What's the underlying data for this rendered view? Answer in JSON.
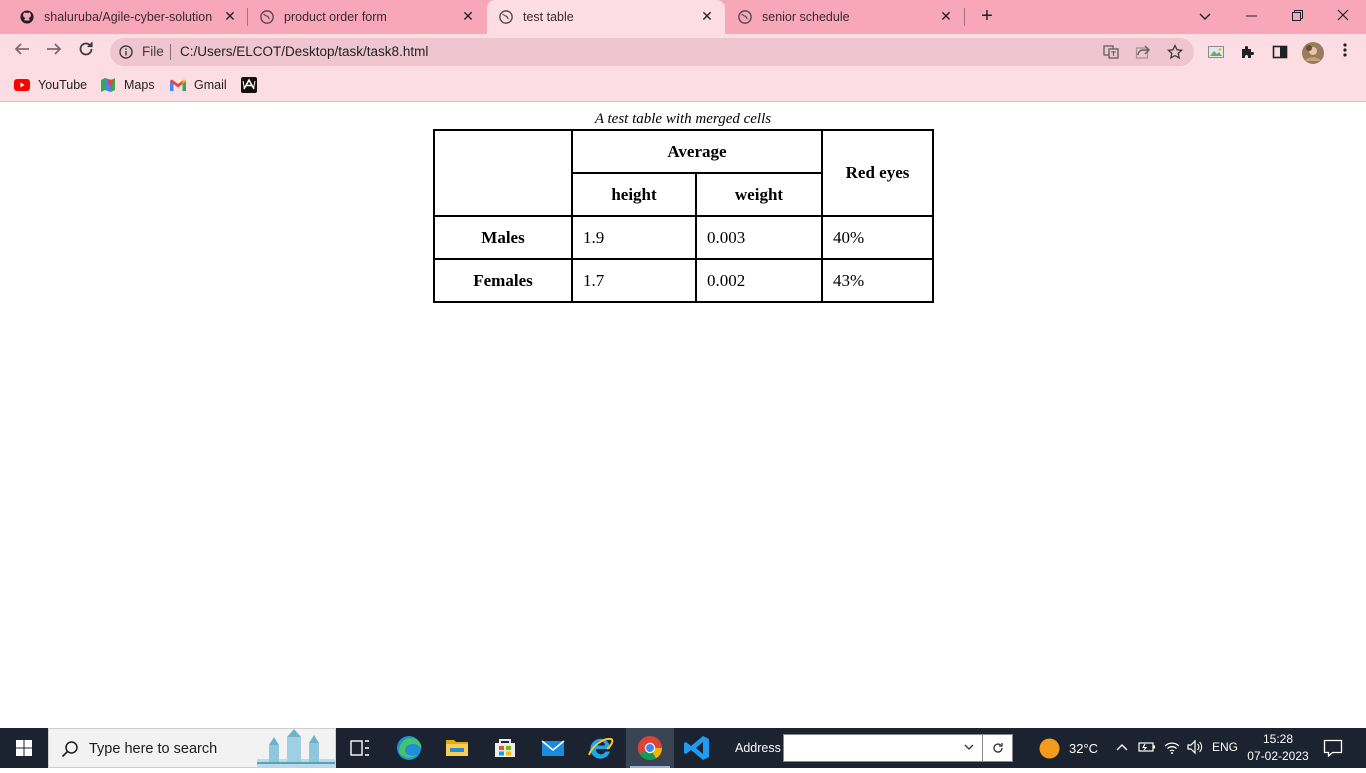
{
  "tabs": [
    {
      "title": "shaluruba/Agile-cyber-solution",
      "icon": "github-icon"
    },
    {
      "title": "product order form",
      "icon": "globe-icon"
    },
    {
      "title": "test table",
      "icon": "globe-icon",
      "active": true
    },
    {
      "title": "senior schedule",
      "icon": "globe-icon"
    }
  ],
  "toolbar": {
    "scheme_label": "File",
    "url": "C:/Users/ELCOT/Desktop/task/task8.html"
  },
  "bookmarks": [
    {
      "label": "YouTube",
      "icon": "youtube-icon"
    },
    {
      "label": "Maps",
      "icon": "maps-icon"
    },
    {
      "label": "Gmail",
      "icon": "gmail-icon"
    },
    {
      "label": "",
      "icon": "app-icon"
    }
  ],
  "page": {
    "caption": "A test table with merged cells",
    "headers": {
      "average": "Average",
      "height": "height",
      "weight": "weight",
      "red_eyes": "Red eyes"
    },
    "rows": [
      {
        "label": "Males",
        "height": "1.9",
        "weight": "0.003",
        "red_eyes": "40%"
      },
      {
        "label": "Females",
        "height": "1.7",
        "weight": "0.002",
        "red_eyes": "43%"
      }
    ]
  },
  "taskbar": {
    "search_placeholder": "Type here to search",
    "address_label": "Address",
    "address_value": "",
    "weather": "32°C",
    "language": "ENG",
    "time": "15:28",
    "date": "07-02-2023"
  },
  "colors": {
    "tabstrip": "#f7a7b8",
    "toolbar": "#fcdde3",
    "taskbar": "#1b2330"
  }
}
